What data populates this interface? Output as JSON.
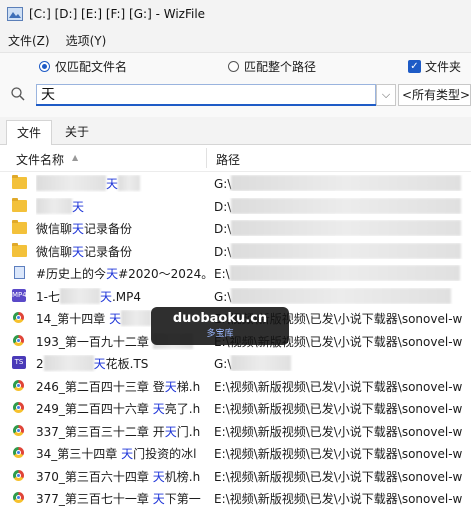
{
  "window": {
    "title": "[C:] [D:] [E:] [F:] [G:]  - WizFile"
  },
  "menu": [
    {
      "label": "文件(Z)"
    },
    {
      "label": "选项(Y)"
    }
  ],
  "search_options": {
    "match_filename": "仅匹配文件名",
    "match_fullpath": "匹配整个路径",
    "folders": "文件夹",
    "match_filename_checked": true,
    "folders_checked": true
  },
  "search": {
    "value": "天",
    "type_filter": "<所有类型>"
  },
  "tabs": [
    {
      "label": "文件"
    },
    {
      "label": "关于"
    }
  ],
  "columns": {
    "name": "文件名称",
    "path": "路径"
  },
  "rows": [
    {
      "icon": "folder-icon",
      "pre": "",
      "hl": "天",
      "post": "",
      "path": "G:\\"
    },
    {
      "icon": "folder-icon",
      "pre": "",
      "hl": "天",
      "post": "",
      "path": "D:\\"
    },
    {
      "icon": "folder-icon",
      "pre": "微信聊",
      "hl": "天",
      "post": "记录备份",
      "path": "D:\\"
    },
    {
      "icon": "folder-icon",
      "pre": "微信聊",
      "hl": "天",
      "post": "记录备份",
      "path": "D:\\"
    },
    {
      "icon": "png-icon",
      "pre": "#历史上的今",
      "hl": "天",
      "post": "#2020～2024。",
      "path": "E:\\"
    },
    {
      "icon": "mp4-icon",
      "pre": "1-七",
      "hl": "天",
      "post": ".MP4",
      "path": "G:\\"
    },
    {
      "icon": "chrome-icon",
      "pre": "14_第十四章 ",
      "hl": "天",
      "post": "",
      "path": "E:\\视频\\新版视频\\已发\\小说下载器\\sonovel-w"
    },
    {
      "icon": "chrome-icon",
      "pre": "193_第一百九十二章 ",
      "hl": "",
      "post": "",
      "path": "E:\\视频\\新版视频\\已发\\小说下载器\\sonovel-w"
    },
    {
      "icon": "ts-icon",
      "pre": "2",
      "hl": "天",
      "post": "花板.TS",
      "path": "G:\\"
    },
    {
      "icon": "chrome-icon",
      "pre": "246_第二百四十三章 登",
      "hl": "天",
      "post": "梯.h",
      "path": "E:\\视频\\新版视频\\已发\\小说下载器\\sonovel-w"
    },
    {
      "icon": "chrome-icon",
      "pre": "249_第二百四十六章 ",
      "hl": "天",
      "post": "亮了.h",
      "path": "E:\\视频\\新版视频\\已发\\小说下载器\\sonovel-w"
    },
    {
      "icon": "chrome-icon",
      "pre": "337_第三百三十二章 开",
      "hl": "天",
      "post": "门.h",
      "path": "E:\\视频\\新版视频\\已发\\小说下载器\\sonovel-w"
    },
    {
      "icon": "chrome-icon",
      "pre": "34_第三十四章 ",
      "hl": "天",
      "post": "门投资的冰l",
      "path": "E:\\视频\\新版视频\\已发\\小说下载器\\sonovel-w"
    },
    {
      "icon": "chrome-icon",
      "pre": "370_第三百六十四章 ",
      "hl": "天",
      "post": "机榜.h",
      "path": "E:\\视频\\新版视频\\已发\\小说下载器\\sonovel-w"
    },
    {
      "icon": "chrome-icon",
      "pre": "377_第三百七十一章 ",
      "hl": "天",
      "post": "下第一",
      "path": "E:\\视频\\新版视频\\已发\\小说下载器\\sonovel-w"
    }
  ],
  "watermark": {
    "line1": "duobaoku.cn",
    "line2": "多宝库"
  },
  "colors": {
    "highlight": "#1e35d8",
    "accent": "#1e5bc6",
    "folder": "#f3c13a"
  }
}
